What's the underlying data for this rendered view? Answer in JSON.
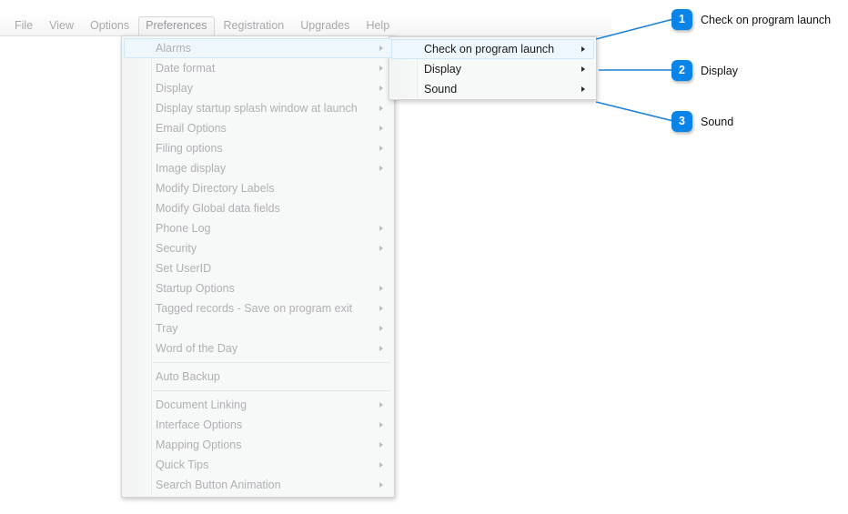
{
  "menubar": {
    "items": [
      {
        "label": "File",
        "open": false
      },
      {
        "label": "View",
        "open": false
      },
      {
        "label": "Options",
        "open": false
      },
      {
        "label": "Preferences",
        "open": true
      },
      {
        "label": "Registration",
        "open": false
      },
      {
        "label": "Upgrades",
        "open": false
      },
      {
        "label": "Help",
        "open": false
      }
    ]
  },
  "preferences_menu": {
    "title": "Preferences",
    "items": [
      {
        "label": "Alarms",
        "arrow": true,
        "highlighted": true,
        "separator_after": false
      },
      {
        "label": "Date format",
        "arrow": true,
        "highlighted": false,
        "separator_after": false
      },
      {
        "label": "Display",
        "arrow": true,
        "highlighted": false,
        "separator_after": false
      },
      {
        "label": "Display startup splash window at launch",
        "arrow": true,
        "highlighted": false,
        "separator_after": false
      },
      {
        "label": "Email Options",
        "arrow": true,
        "highlighted": false,
        "separator_after": false
      },
      {
        "label": "Filing options",
        "arrow": true,
        "highlighted": false,
        "separator_after": false
      },
      {
        "label": "Image display",
        "arrow": true,
        "highlighted": false,
        "separator_after": false
      },
      {
        "label": "Modify Directory Labels",
        "arrow": false,
        "highlighted": false,
        "separator_after": false
      },
      {
        "label": "Modify Global data fields",
        "arrow": false,
        "highlighted": false,
        "separator_after": false
      },
      {
        "label": "Phone Log",
        "arrow": true,
        "highlighted": false,
        "separator_after": false
      },
      {
        "label": "Security",
        "arrow": true,
        "highlighted": false,
        "separator_after": false
      },
      {
        "label": "Set UserID",
        "arrow": false,
        "highlighted": false,
        "separator_after": false
      },
      {
        "label": "Startup Options",
        "arrow": true,
        "highlighted": false,
        "separator_after": false
      },
      {
        "label": "Tagged records - Save on program exit",
        "arrow": true,
        "highlighted": false,
        "separator_after": false
      },
      {
        "label": "Tray",
        "arrow": true,
        "highlighted": false,
        "separator_after": false
      },
      {
        "label": "Word of the Day",
        "arrow": true,
        "highlighted": false,
        "separator_after": true
      },
      {
        "label": "Auto Backup",
        "arrow": false,
        "highlighted": false,
        "separator_after": true
      },
      {
        "label": "Document Linking",
        "arrow": true,
        "highlighted": false,
        "separator_after": false
      },
      {
        "label": "Interface Options",
        "arrow": true,
        "highlighted": false,
        "separator_after": false
      },
      {
        "label": "Mapping Options",
        "arrow": true,
        "highlighted": false,
        "separator_after": false
      },
      {
        "label": "Quick Tips",
        "arrow": true,
        "highlighted": false,
        "separator_after": false
      },
      {
        "label": "Search Button Animation",
        "arrow": true,
        "highlighted": false,
        "separator_after": false
      }
    ]
  },
  "alarms_submenu": {
    "parent": "Alarms",
    "items": [
      {
        "label": "Check on program launch",
        "arrow": true,
        "highlighted": true
      },
      {
        "label": "Display",
        "arrow": true,
        "highlighted": false
      },
      {
        "label": "Sound",
        "arrow": true,
        "highlighted": false
      }
    ]
  },
  "callouts": {
    "accent_color": "#0a84e8",
    "items": [
      {
        "number": "1",
        "text": "Check on program launch"
      },
      {
        "number": "2",
        "text": "Display"
      },
      {
        "number": "3",
        "text": "Sound"
      }
    ]
  }
}
